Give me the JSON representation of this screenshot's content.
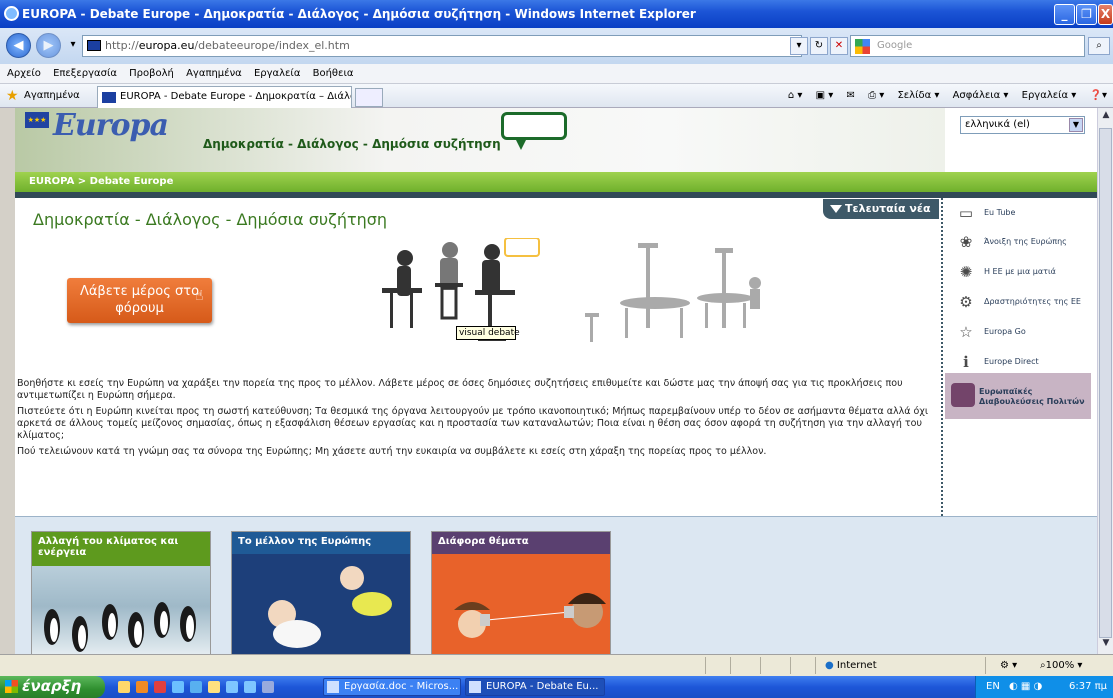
{
  "window": {
    "title": "EUROPA - Debate Europe - Δημοκρατία - Διάλογος - Δημόσια συζήτηση - Windows Internet Explorer"
  },
  "address": {
    "url_prefix": "http://",
    "url_domain": "europa.eu",
    "url_path": "/debateeurope/index_el.htm",
    "search_placeholder": "Google"
  },
  "menu": {
    "items": [
      "Αρχείο",
      "Επεξεργασία",
      "Προβολή",
      "Αγαπημένα",
      "Εργαλεία",
      "Βοήθεια"
    ]
  },
  "favorites": {
    "label": "Αγαπημένα",
    "tab_title": "EUROPA - Debate Europe - Δημοκρατία – Διάλογος – ..."
  },
  "toolbar": {
    "page": "Σελίδα ▾",
    "safety": "Ασφάλεια ▾",
    "tools": "Εργαλεία ▾"
  },
  "header": {
    "logo_text": "Europa",
    "title": "Δημοκρατία - Διάλογος - Δημόσια συζήτηση",
    "language": "ελληνικά (el)"
  },
  "breadcrumb": "EUROPA > Debate Europe",
  "main": {
    "page_title": "Δημοκρατία - Διάλογος - Δημόσια συζήτηση",
    "news_button": "Τελευταία νέα",
    "forum_button": "Λάβετε μέρος στο φόρουμ",
    "tooltip": "visual debate",
    "paragraphs": [
      "Βοηθήστε κι εσείς την Ευρώπη να χαράξει την πορεία της προς το μέλλον. Λάβετε μέρος σε όσες δημόσιες συζητήσεις επιθυμείτε και δώστε μας την άποψή σας για τις προκλήσεις που αντιμετωπίζει η Ευρώπη σήμερα.",
      "Πιστεύετε ότι η Ευρώπη κινείται προς τη σωστή κατεύθυνση; Τα θεσμικά της όργανα λειτουργούν με τρόπο ικανοποιητικό; Μήπως παρεμβαίνουν υπέρ το δέον σε ασήμαντα θέματα αλλά όχι αρκετά σε άλλους τομείς μείζονος σημασίας, όπως η εξασφάλιση θέσεων εργασίας και η προστασία των καταναλωτών; Ποια είναι η θέση σας όσον αφορά τη συζήτηση για την αλλαγή του κλίματος;",
      "Πού τελειώνουν κατά τη γνώμη σας τα σύνορα της Ευρώπης; Μη χάσετε αυτή την ευκαιρία να συμβάλετε κι εσείς στη χάραξη της πορείας προς το μέλλον."
    ]
  },
  "sidebar": {
    "items": [
      {
        "label": "Eu Tube",
        "icon": "tv-icon"
      },
      {
        "label": "Άνοιξη της Ευρώπης",
        "icon": "flower-icon"
      },
      {
        "label": "Η ΕΕ με μια ματιά",
        "icon": "stars-circle-icon"
      },
      {
        "label": "Δραστηριότητες της ΕΕ",
        "icon": "gears-icon"
      },
      {
        "label": "Europa Go",
        "icon": "star-person-icon"
      },
      {
        "label": "Europe Direct",
        "icon": "info-person-icon"
      }
    ],
    "citizens": "Ευρωπαϊκές Διαβουλεύσεις Πολιτών"
  },
  "cards": [
    {
      "label": "Αλλαγή του κλίματος και ενέργεια",
      "color": "#5e9a1e"
    },
    {
      "label": "Το μέλλον της Ευρώπης",
      "color": "#1f5a96"
    },
    {
      "label": "Διάφορα θέματα",
      "color": "#5a4070"
    }
  ],
  "status": {
    "zone": "Internet",
    "zoom": "100%"
  },
  "taskbar": {
    "start": "έναρξη",
    "buttons": [
      "Εργασία.doc - Micros...",
      "EUROPA - Debate Eu..."
    ],
    "lang": "EN",
    "time": "6:37 πμ"
  }
}
